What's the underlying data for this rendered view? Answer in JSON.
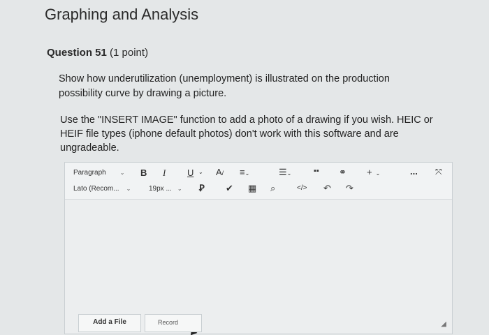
{
  "page": {
    "title": "Graphing and Analysis"
  },
  "question": {
    "number": "Question 51",
    "points": "(1 point)",
    "prompt": "Show how underutilization (unemployment) is illustrated on the production possibility curve by drawing a picture.",
    "instruction": "Use the \"INSERT IMAGE\" function to add a photo of a drawing if you wish. HEIC or HEIF file types (iphone default photos) don't work with this software and are ungradeable."
  },
  "editor": {
    "block_format": "Paragraph",
    "font_family": "Lato (Recom...",
    "font_size": "19px ...",
    "bold": "B",
    "italic": "I",
    "underline": "U",
    "insert_plus": "+",
    "more": "...",
    "code": "</>"
  },
  "footer": {
    "add_file": "Add a File",
    "record": "Record"
  },
  "icons": {
    "text_color": "text-color-icon",
    "align": "align-icon",
    "list": "list-icon",
    "media": "media-icon",
    "link": "link-icon",
    "format_painter": "format-painter-icon",
    "spellcheck": "spellcheck-icon",
    "table": "table-icon",
    "preview": "preview-icon",
    "undo": "undo-icon",
    "redo": "redo-icon",
    "fullscreen": "fullscreen-icon",
    "resize": "resize-handle-icon"
  }
}
